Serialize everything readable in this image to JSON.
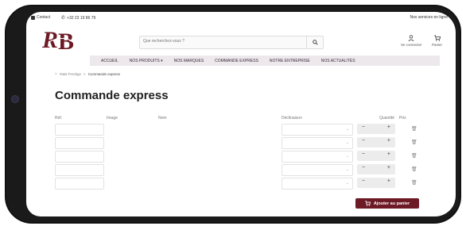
{
  "topbar": {
    "contact_label": "Contact",
    "phone": "+32 23 19 86 79",
    "services_label": "Nos services en ligne"
  },
  "logo": {
    "text": "RB"
  },
  "search": {
    "placeholder": "Que recherchez-vous ?"
  },
  "account": {
    "login_label": "Se connecter",
    "cart_label": "Panier"
  },
  "nav": {
    "items": [
      "ACCUEIL",
      "NOS PRODUITS ▾",
      "NOS MARQUES",
      "COMMANDE EXPRESS",
      "NOTRE ENTREPRISE",
      "NOS ACTUALITÉS"
    ]
  },
  "breadcrumb": {
    "home": "R&B Prestige",
    "separator": ">",
    "current": "Commande express"
  },
  "page": {
    "title": "Commande express"
  },
  "table": {
    "headers": {
      "ref": "Réf.",
      "image": "Image",
      "name": "Nom",
      "declinaison": "Déclinaison",
      "quantity": "Quantité",
      "price": "Prix"
    },
    "rows": 5,
    "qty_minus": "−",
    "qty_plus": "+",
    "select_chevron": "⌄",
    "trash_glyph": "🗑"
  },
  "actions": {
    "add_to_cart": "Ajouter au panier"
  },
  "colors": {
    "accent": "#6d1a26",
    "nav_bg": "#ece8ec"
  }
}
